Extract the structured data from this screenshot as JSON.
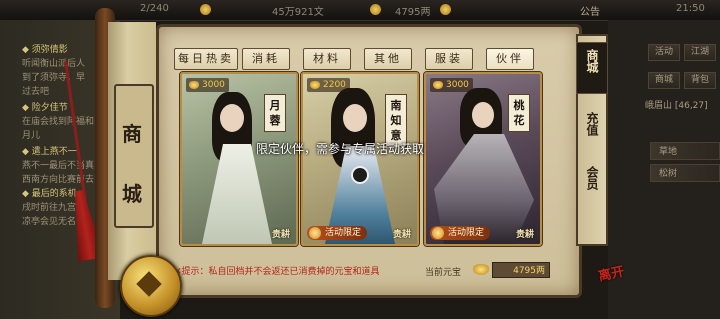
{
  "topbar": {
    "level_progress": "2/240",
    "exp_readout": "45万921文",
    "silver": "4795两",
    "announcement": "公告",
    "clock": "21:50"
  },
  "quest_log": {
    "lines": [
      {
        "text": "◆ 须弥倩影",
        "highlight": true
      },
      {
        "text": "听闻衡山派后人",
        "highlight": false
      },
      {
        "text": "到了须弥寺，早",
        "highlight": false
      },
      {
        "text": "过去吧",
        "highlight": false
      },
      {
        "text": "◆ 险夕佳节",
        "highlight": true
      },
      {
        "text": "在庙会找到阿福和",
        "highlight": false
      },
      {
        "text": "月儿",
        "highlight": false
      },
      {
        "text": "◆ 遣上燕不一",
        "highlight": true
      },
      {
        "text": "燕不一最后不当真",
        "highlight": false
      },
      {
        "text": "西南方向比赛前去",
        "highlight": false
      },
      {
        "text": "◆ 最后的系机",
        "highlight": true
      },
      {
        "text": "戌时前往九宫山",
        "highlight": false
      },
      {
        "text": "凉亭会见无名",
        "highlight": false
      }
    ]
  },
  "shop": {
    "title_chars": [
      "商",
      "城"
    ],
    "tabs": [
      {
        "label": "每日热卖",
        "active": false
      },
      {
        "label": "消耗",
        "active": false
      },
      {
        "label": "材料",
        "active": false
      },
      {
        "label": "其他",
        "active": false
      },
      {
        "label": "服装",
        "active": false
      },
      {
        "label": "伙伴",
        "active": true
      }
    ],
    "cards": [
      {
        "name": "月蓉",
        "price": "3000",
        "badge": "",
        "rarity": "贵耕"
      },
      {
        "name": "南知意",
        "price": "2200",
        "badge": "活动限定",
        "rarity": "贵耕"
      },
      {
        "name": "桃花",
        "price": "3000",
        "badge": "活动限定",
        "rarity": "贵耕"
      }
    ],
    "toast": "限定伙伴，需参与专属活动获取",
    "tip": "✕提示：私自回档并不会返还已消费掉的元宝和道具",
    "balance_label": "当前元宝",
    "balance_value": "4795两"
  },
  "side_menu": {
    "items": [
      {
        "label": "商城",
        "active": true
      },
      {
        "label": "充值",
        "active": false
      },
      {
        "label": "会员",
        "active": false
      }
    ]
  },
  "right_hud": {
    "buttons": [
      "活动",
      "江湖",
      "商城",
      "背包"
    ],
    "location": "峨眉山 [46,27]",
    "rows": [
      "草地",
      "松树"
    ]
  },
  "exit_seal": "离开",
  "colors": {
    "tip_red": "#b4241b",
    "gold": "#f5c842",
    "panel_paper": "#d9ccab",
    "card_border": "#b78c45"
  }
}
